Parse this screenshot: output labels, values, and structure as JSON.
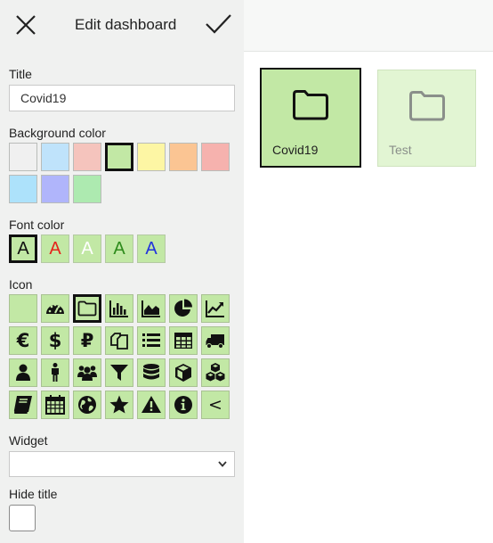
{
  "header": {
    "title": "Edit dashboard"
  },
  "form": {
    "title_label": "Title",
    "title_value": "Covid19",
    "background_label": "Background color",
    "background_colors": [
      "#f0f0f0",
      "#bfe3fb",
      "#f5c4bd",
      "#c2e8a5",
      "#fdf6a4",
      "#fbc593",
      "#f6b2ae",
      "#ade2fb",
      "#b0b5fb",
      "#adeab0"
    ],
    "background_selected": "#c2e8a5",
    "font_label": "Font color",
    "font_sample_glyph": "A",
    "font_colors": [
      "#111111",
      "#e5231b",
      "#ffffff",
      "#2e8b1c",
      "#2233dd"
    ],
    "font_selected": "#111111",
    "icon_label": "Icon",
    "icons": [
      "none",
      "dashboard-gauge-icon",
      "folder-icon",
      "bar-chart-icon",
      "area-chart-icon",
      "pie-chart-icon",
      "line-chart-icon",
      "euro-icon",
      "dollar-icon",
      "ruble-icon",
      "copy-icon",
      "list-icon",
      "table-icon",
      "truck-icon",
      "user-icon",
      "male-icon",
      "users-icon",
      "filter-icon",
      "database-icon",
      "cube-icon",
      "cubes-icon",
      "book-icon",
      "calendar-icon",
      "globe-icon",
      "star-icon",
      "warning-icon",
      "info-icon",
      "less-than-icon"
    ],
    "icon_glyphs": {
      "euro": "€",
      "dollar": "$",
      "ruble": "₽",
      "less": "<"
    },
    "icon_selected": "folder-icon",
    "widget_label": "Widget",
    "widget_value": "",
    "hide_title_label": "Hide title",
    "hide_title_checked": false
  },
  "preview": {
    "tiles": [
      {
        "label": "Covid19",
        "icon": "folder-icon",
        "background": "#c2e8a5",
        "active": true
      },
      {
        "label": "Test",
        "icon": "folder-icon",
        "background": "#e2f5d3",
        "active": false
      }
    ]
  }
}
